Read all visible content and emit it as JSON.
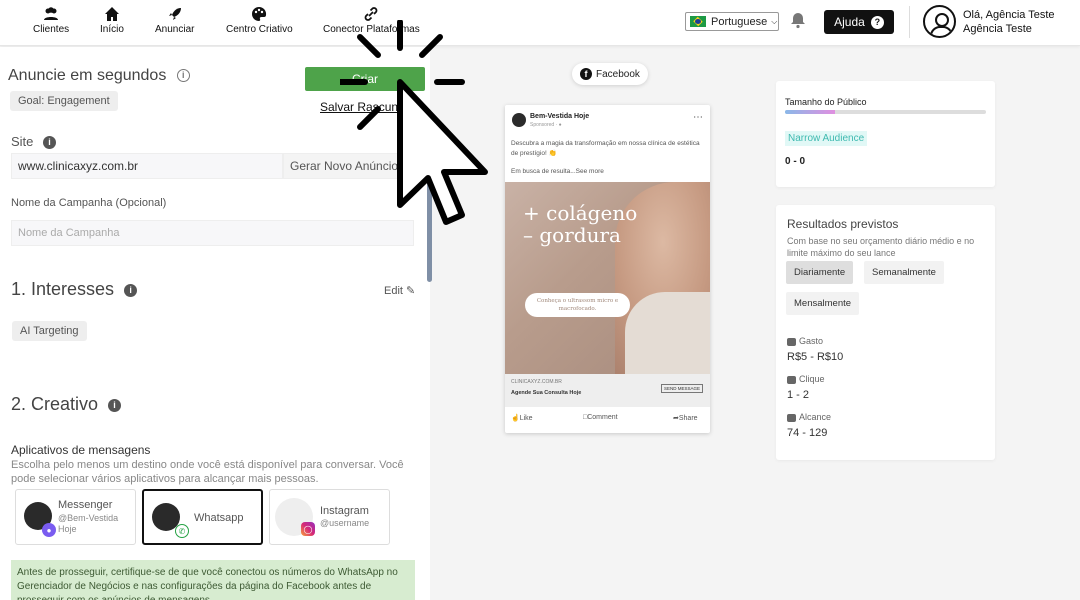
{
  "topbar": {
    "nav": [
      {
        "label": "Clientes",
        "icon": "users-icon"
      },
      {
        "label": "Início",
        "icon": "home-icon"
      },
      {
        "label": "Anunciar",
        "icon": "rocket-icon"
      },
      {
        "label": "Centro Criativo",
        "icon": "palette-icon"
      },
      {
        "label": "Conector Plataformas",
        "icon": "link-icon"
      }
    ],
    "language": "Portuguese",
    "help_label": "Ajuda",
    "user_line1": "Olá, Agência Teste",
    "user_line2": "Agência Teste"
  },
  "form": {
    "title": "Anuncie em segundos",
    "goal": "Goal: Engagement",
    "create_label": "Criar",
    "save_draft_label": "Salvar Rascunho",
    "site_label": "Site",
    "site_value": "www.clinicaxyz.com.br",
    "generate_label": "Gerar Novo Anúncio",
    "campaign_label": "Nome da Campanha (Opcional)",
    "campaign_placeholder": "Nome da Campanha",
    "section1": "1.  Interesses",
    "edit_label": "Edit",
    "ai_targeting": "AI Targeting",
    "section2": "2.  Creativo",
    "messaging_title": "Aplicativos de mensagens",
    "messaging_desc": "Escolha pelo menos um destino onde você está disponível para conversar. Você pode selecionar vários aplicativos para alcançar mais pessoas.",
    "apps": [
      {
        "name": "Messenger",
        "sub": "@Bem-Vestida Hoje"
      },
      {
        "name": "Whatsapp",
        "sub": ""
      },
      {
        "name": "Instagram",
        "sub": "@username"
      }
    ],
    "notice": "Antes de prosseguir, certifique-se de que você conectou os números do WhatsApp no Gerenciador de Negócios e nas configurações da página do Facebook antes de prosseguir com os anúncios de mensagens."
  },
  "preview": {
    "platform": "Facebook",
    "page_name": "Bem-Vestida Hoje",
    "sponsored": "Sponsored · ",
    "text": "Descubra a magia da transformação em nossa clínica de estética de prestígio! 👏",
    "more": "Em busca de resulta...See more",
    "headline_1": "+ colágeno",
    "headline_2": "– gordura",
    "pill_text": "Conheça o ultrassom micro e macrofocado.",
    "link_url": "CLINICAXYZ.COM.BR",
    "link_title": "Agende Sua Consulta Hoje",
    "send_label": "SEND MESSAGE",
    "like": "Like",
    "comment": "Comment",
    "share": "Share"
  },
  "audience": {
    "title": "Tamanho do Público",
    "tag": "Narrow Audience",
    "range": "0 - 0"
  },
  "results": {
    "title": "Resultados previstos",
    "desc": "Com base no seu orçamento diário médio e no limite máximo do seu lance",
    "tabs": [
      "Diariamente",
      "Semanalmente",
      "Mensalmente"
    ],
    "spend_label": "Gasto",
    "spend_value": "R$5 - R$10",
    "clicks_label": "Clique",
    "clicks_value": "1 - 2",
    "reach_label": "Alcance",
    "reach_value": "74 - 129"
  }
}
